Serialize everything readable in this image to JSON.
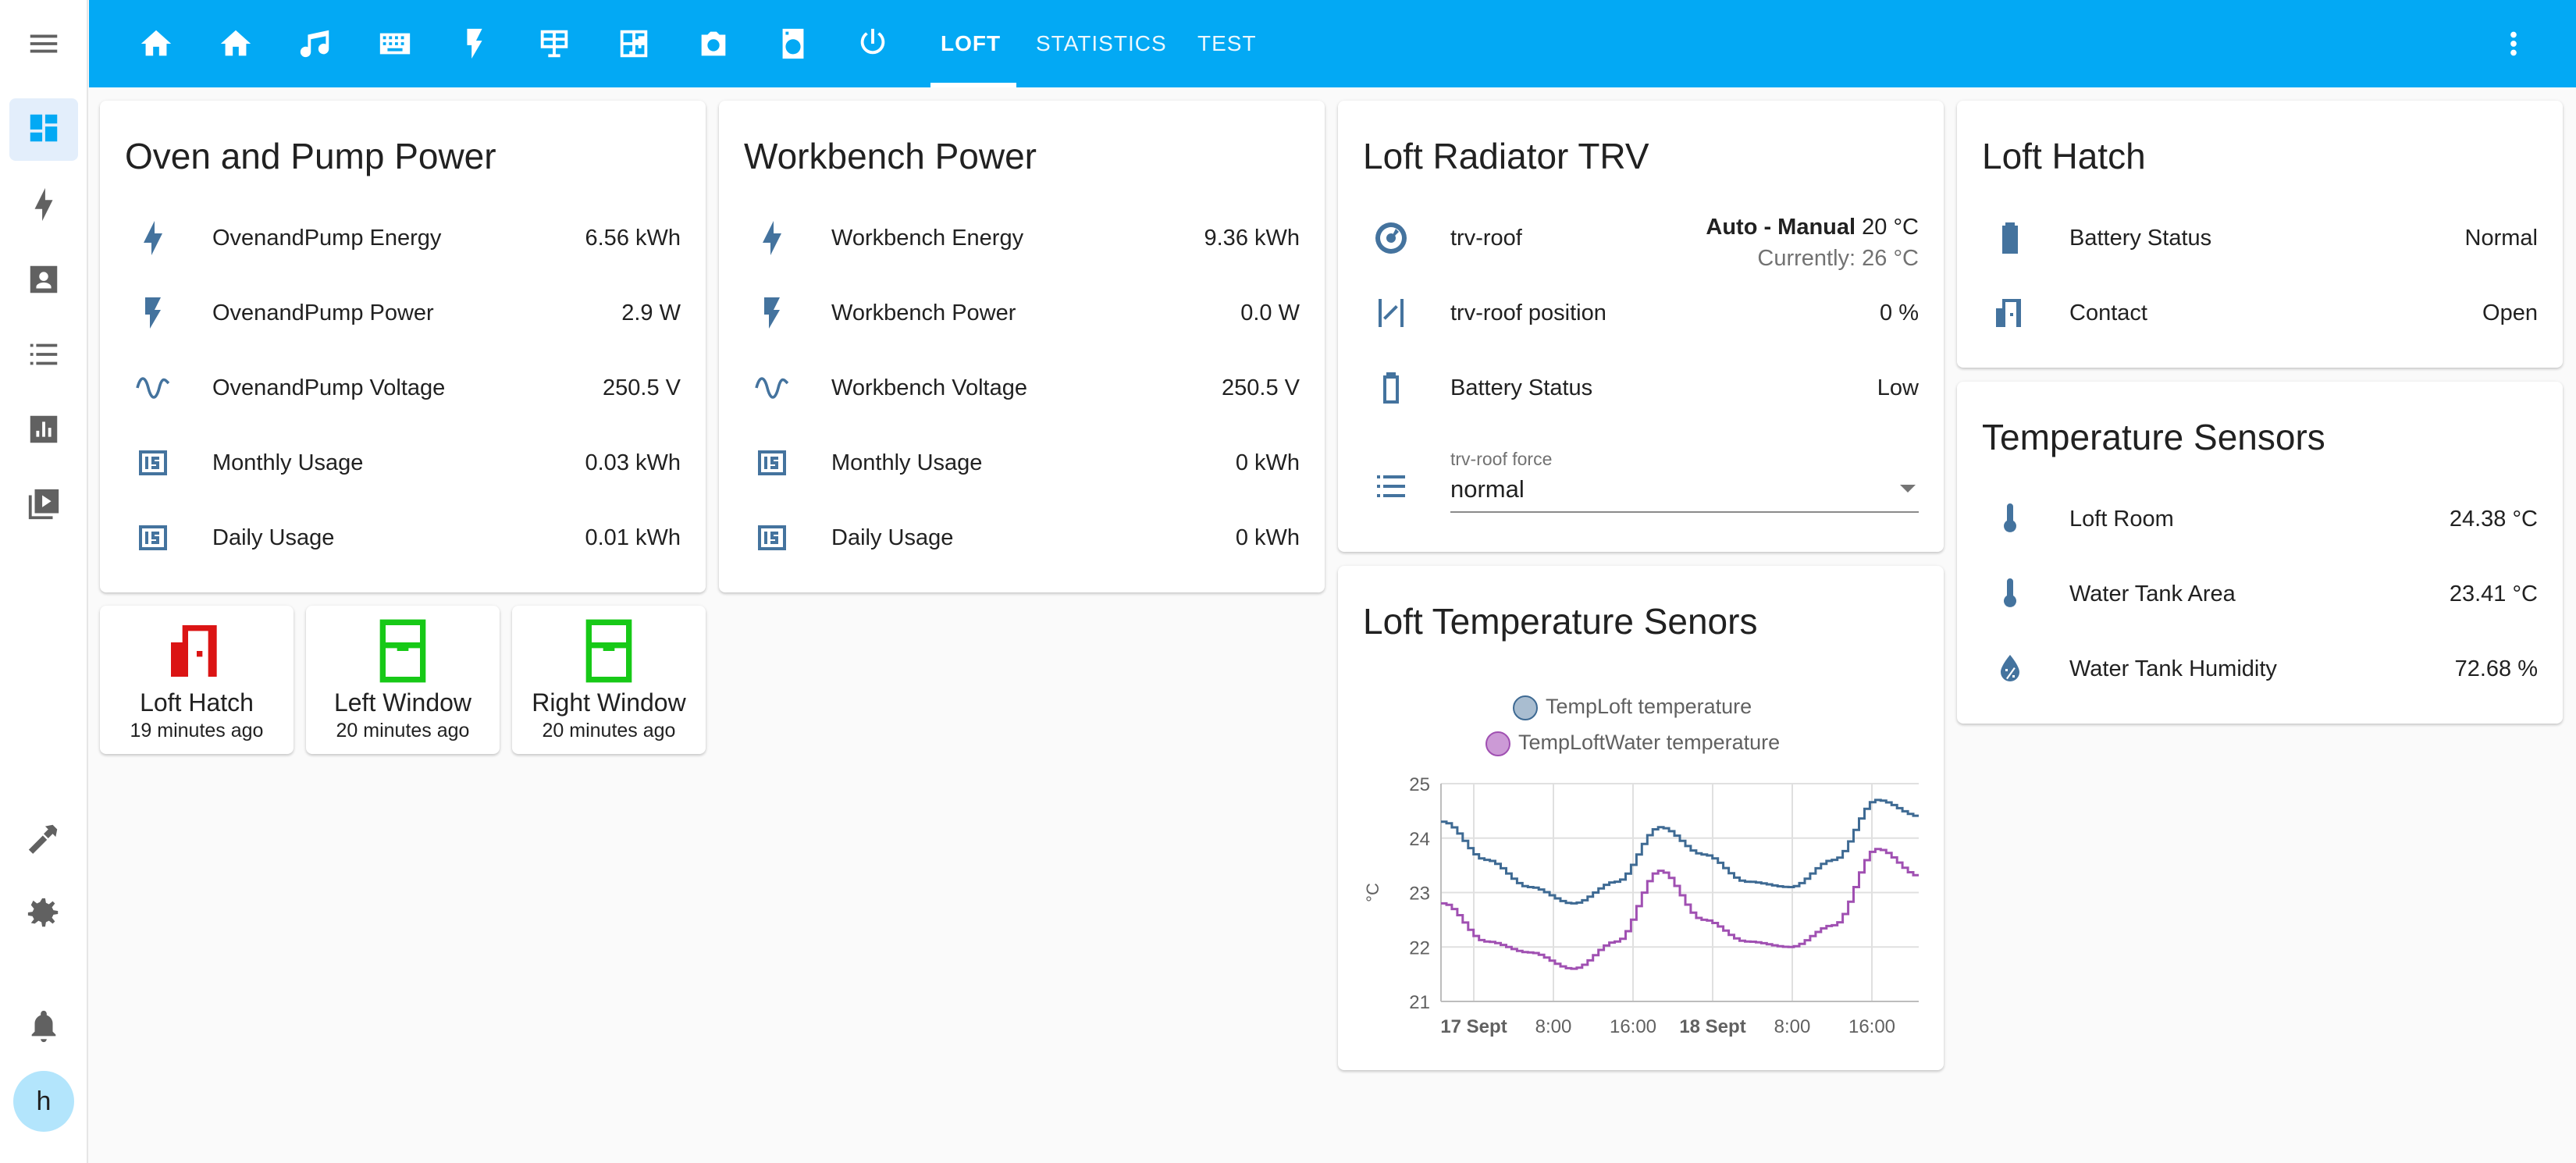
{
  "colors": {
    "accent": "#03a9f4",
    "icon": "#44739e",
    "open": "#db1414",
    "closed": "#17c917",
    "series1": "#3e6a93",
    "series2": "#a050b2"
  },
  "sidebar": {
    "icons": [
      "dashboard-icon",
      "lightning-icon",
      "account-box-icon",
      "list-icon",
      "chart-icon",
      "media-icon",
      "hammer-icon",
      "gear-icon",
      "bell-icon"
    ],
    "user_initial": "h"
  },
  "topbar": {
    "tabs": [
      "LOFT",
      "STATISTICS",
      "TEST"
    ],
    "active_tab": "LOFT",
    "icons": [
      "home-icon",
      "home-outline-icon",
      "music-icon",
      "keyboard-icon",
      "flash-icon",
      "solar-panel-icon",
      "floor-plan-icon",
      "camera-icon",
      "washing-machine-icon",
      "power-icon"
    ]
  },
  "oven": {
    "title": "Oven and Pump Power",
    "rows": [
      {
        "icon": "lightning-icon",
        "label": "OvenandPump Energy",
        "value": "6.56 kWh"
      },
      {
        "icon": "flash-icon",
        "label": "OvenandPump Power",
        "value": "2.9 W"
      },
      {
        "icon": "sine-wave-icon",
        "label": "OvenandPump Voltage",
        "value": "250.5 V"
      },
      {
        "icon": "counter-icon",
        "label": "Monthly Usage",
        "value": "0.03 kWh"
      },
      {
        "icon": "counter-icon",
        "label": "Daily Usage",
        "value": "0.01 kWh"
      }
    ]
  },
  "workbench": {
    "title": "Workbench Power",
    "rows": [
      {
        "icon": "lightning-icon",
        "label": "Workbench Energy",
        "value": "9.36 kWh"
      },
      {
        "icon": "flash-icon",
        "label": "Workbench Power",
        "value": "0.0 W"
      },
      {
        "icon": "sine-wave-icon",
        "label": "Workbench Voltage",
        "value": "250.5 V"
      },
      {
        "icon": "counter-icon",
        "label": "Monthly Usage",
        "value": "0 kWh"
      },
      {
        "icon": "counter-icon",
        "label": "Daily Usage",
        "value": "0 kWh"
      }
    ]
  },
  "trv": {
    "title": "Loft Radiator TRV",
    "climate": {
      "label": "trv-roof",
      "mode": "Auto - Manual",
      "target": "20 °C",
      "current": "Currently: 26 °C"
    },
    "position": {
      "label": "trv-roof position",
      "value": "0 %"
    },
    "battery": {
      "label": "Battery Status",
      "value": "Low"
    },
    "force": {
      "label": "trv-roof force",
      "value": "normal"
    }
  },
  "hatch": {
    "title": "Loft Hatch",
    "rows": [
      {
        "icon": "battery-icon",
        "label": "Battery Status",
        "value": "Normal"
      },
      {
        "icon": "door-open-icon",
        "label": "Contact",
        "value": "Open"
      }
    ]
  },
  "temps": {
    "title": "Temperature Sensors",
    "rows": [
      {
        "icon": "thermometer-icon",
        "label": "Loft Room",
        "value": "24.38 °C"
      },
      {
        "icon": "thermometer-icon",
        "label": "Water Tank Area",
        "value": "23.41 °C"
      },
      {
        "icon": "water-percent-icon",
        "label": "Water Tank Humidity",
        "value": "72.68 %"
      }
    ]
  },
  "entities": [
    {
      "name": "Loft Hatch",
      "time": "19 minutes ago",
      "state": "open"
    },
    {
      "name": "Left Window",
      "time": "20 minutes ago",
      "state": "closed"
    },
    {
      "name": "Right Window",
      "time": "20 minutes ago",
      "state": "closed"
    }
  ],
  "chart_card": {
    "title": "Loft Temperature Senors"
  },
  "chart_data": {
    "type": "line",
    "title": "",
    "ylabel": "°C",
    "ylim": [
      21,
      25
    ],
    "yticks": [
      "25",
      "24",
      "23",
      "22",
      "21"
    ],
    "xticks": [
      "17 Sept",
      "8:00",
      "16:00",
      "18 Sept",
      "8:00",
      "16:00"
    ],
    "xticks_bold": [
      true,
      false,
      false,
      true,
      false,
      false
    ],
    "x": [
      "17 Sept 00:00",
      "17 Sept 04:00",
      "17 Sept 08:00",
      "17 Sept 12:00",
      "17 Sept 16:00",
      "17 Sept 20:00",
      "18 Sept 00:00",
      "18 Sept 04:00",
      "18 Sept 08:00",
      "18 Sept 12:00",
      "18 Sept 16:00",
      "18 Sept 20:00"
    ],
    "series": [
      {
        "name": "TempLoft temperature",
        "values": [
          24.3,
          23.6,
          23.1,
          22.8,
          23.2,
          24.2,
          23.7,
          23.2,
          23.1,
          23.6,
          24.7,
          24.4
        ]
      },
      {
        "name": "TempLoftWater temperature",
        "values": [
          22.8,
          22.1,
          21.9,
          21.6,
          22.1,
          23.4,
          22.5,
          22.1,
          22.0,
          22.4,
          23.8,
          23.3
        ]
      }
    ],
    "grid": true,
    "legend_position": "top"
  }
}
